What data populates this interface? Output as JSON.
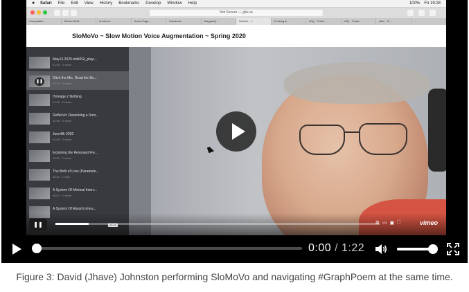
{
  "mac": {
    "menu_items": [
      "Safari",
      "File",
      "Edit",
      "View",
      "History",
      "Bookmarks",
      "Develop",
      "Window",
      "Help"
    ],
    "status_time": "Fri 19:28",
    "battery": "100%",
    "address": "Not Secure — glia.ca",
    "tabs": [
      "Computatio...",
      "Section Edit...",
      "ai interve...",
      "Home Page...",
      "Facebook",
      "Margaret(...",
      "Sublimi... ×",
      "Cooking A...",
      "ePly · Custo...",
      "ePly · Custo...",
      "allen · D...",
      "..."
    ]
  },
  "page": {
    "title": "SloMoVo ~ Slow Motion Voice Augmentation ~ Spring 2020"
  },
  "playlist": [
    {
      "title": "May13-2020-midi2Gt_playi...",
      "meta": "01:35 · 4 views",
      "active": false
    },
    {
      "title": "Ditch the Mic, Read the Bo...",
      "meta": "04:19 · 3 views",
      "active": true
    },
    {
      "title": "Homage 2 Nothing",
      "meta": "01:26 · 6 views",
      "active": false
    },
    {
      "title": "SloMoVo: Reworking a Smo...",
      "meta": "02:56 · 5 views",
      "active": false
    },
    {
      "title": "June4th 2020",
      "meta": "04:05 · 3 views",
      "active": false
    },
    {
      "title": "Exploring the Resonant Fre...",
      "meta": "15:20 · 2 views",
      "active": false
    },
    {
      "title": "The Birth of Loss (Paramete...",
      "meta": "05:20 · 1 view",
      "active": false
    },
    {
      "title": "A System Of Minimal Interv...",
      "meta": "06:07 · 2 views",
      "active": false
    },
    {
      "title": "A System Of Absorb Interv...",
      "meta": "",
      "active": false
    }
  ],
  "vimeo": {
    "bubble_time": "00:29",
    "logo": "vimeo"
  },
  "player": {
    "current_time": "0:00",
    "separator": "/",
    "duration": "1:22",
    "progress": 0.0,
    "volume": 0.92
  },
  "caption": "Figure 3: David (Jhave) Johnston performing SloMoVo and navigating #GraphPoem at the same time."
}
